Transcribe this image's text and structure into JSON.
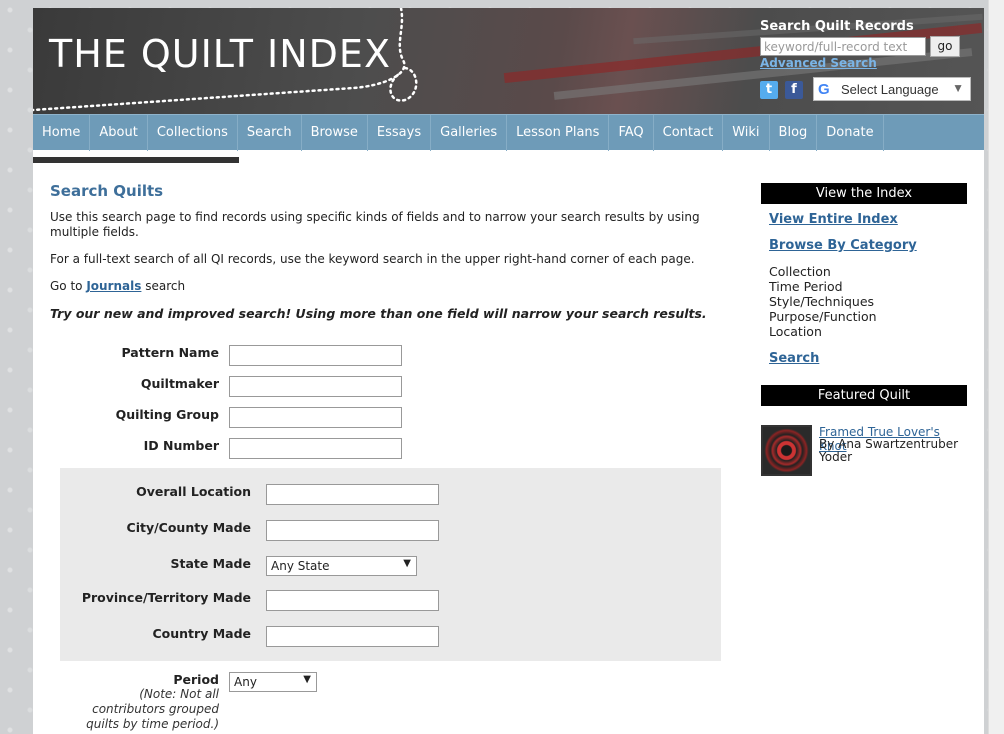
{
  "header": {
    "logo_text": "THE QUILT INDEX",
    "search_title": "Search Quilt Records",
    "search_placeholder": "keyword/full-record text",
    "go_label": "go",
    "advanced_label": "Advanced Search",
    "language_label": "Select Language"
  },
  "nav": {
    "items": [
      "Home",
      "About",
      "Collections",
      "Search",
      "Browse",
      "Essays",
      "Galleries",
      "Lesson Plans",
      "FAQ",
      "Contact",
      "Wiki",
      "Blog",
      "Donate"
    ]
  },
  "main": {
    "title": "Search Quilts",
    "intro1": "Use this search page to find records using specific kinds of fields and to narrow your search results by using multiple fields.",
    "intro2": "For a full-text search of all QI records, use the keyword search in the upper right-hand corner of each page.",
    "goto_prefix": "Go to",
    "journals_link": "Journals",
    "goto_suffix": "search",
    "tip": "Try our new and improved search! Using more than one field will narrow your search results.",
    "fields": {
      "pattern_name": "Pattern Name",
      "quiltmaker": "Quiltmaker",
      "quilting_group": "Quilting Group",
      "id_number": "ID Number",
      "overall_location": "Overall Location",
      "city_county": "City/County Made",
      "state_made": "State Made",
      "state_value": "Any State",
      "province": "Province/Territory Made",
      "country": "Country Made",
      "period": "Period",
      "period_value": "Any",
      "period_note": "(Note: Not all contributors grouped quilts by time period.)"
    }
  },
  "sidebar": {
    "view_head": "View the Index",
    "view_entire": "View Entire Index",
    "browse_cat": "Browse By Category",
    "categories": [
      "Collection",
      "Time Period",
      "Style/Techniques",
      "Purpose/Function",
      "Location"
    ],
    "search_link": "Search",
    "featured_head": "Featured Quilt",
    "featured_title": "Framed True Lover's Knot",
    "featured_by": "By Ana Swartzentruber Yoder"
  }
}
